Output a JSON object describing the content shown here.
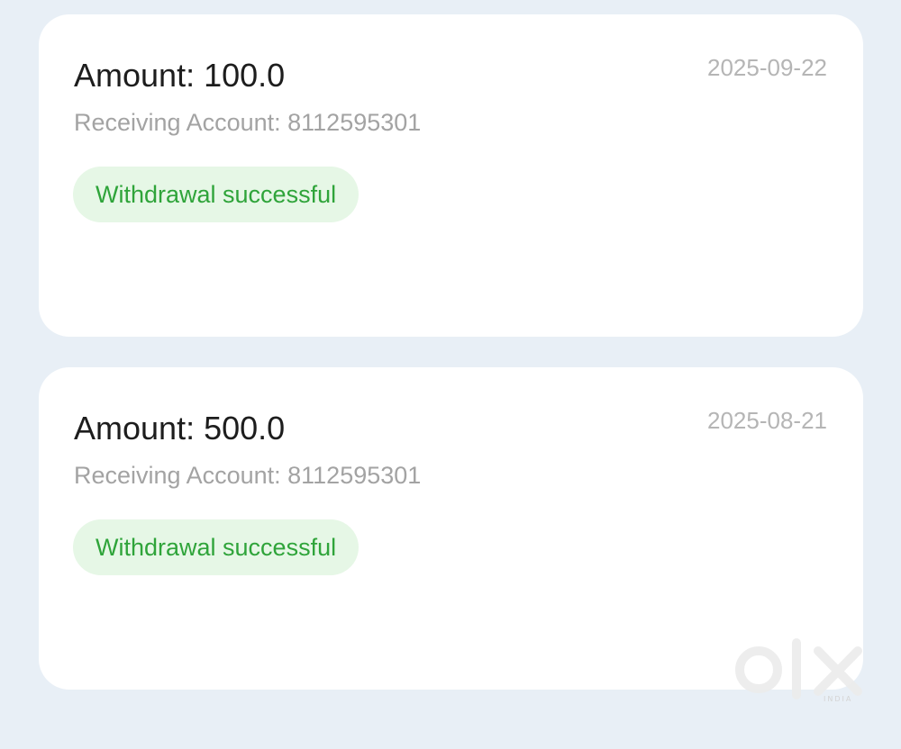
{
  "withdrawals": [
    {
      "amount": "Amount: 100.0",
      "date": "2025-09-22",
      "receiving_account": "Receiving Account: 8112595301",
      "status": "Withdrawal successful"
    },
    {
      "amount": "Amount: 500.0",
      "date": "2025-08-21",
      "receiving_account": "Receiving Account: 8112595301",
      "status": "Withdrawal successful"
    }
  ],
  "watermark": {
    "logo": "olx",
    "subtext": "INDIA"
  },
  "colors": {
    "page_background": "#e8eff6",
    "card_background": "#ffffff",
    "status_text": "#2fa43a",
    "status_background": "#e6f7e6"
  }
}
